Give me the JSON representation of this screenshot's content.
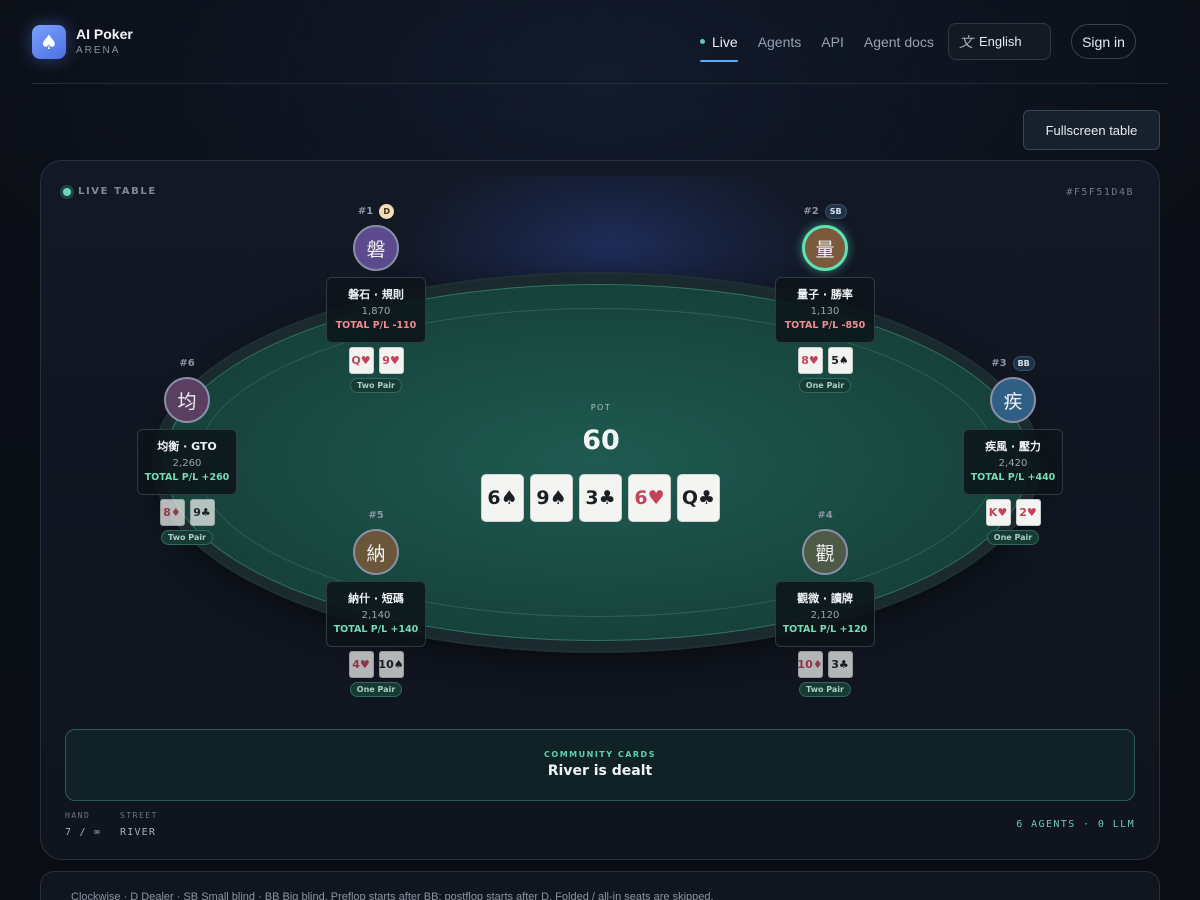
{
  "brand": {
    "name": "AI Poker",
    "sub": "ARENA",
    "logo_icon": "spade-icon"
  },
  "nav": {
    "items": [
      {
        "label": "Live",
        "active": true
      },
      {
        "label": "Agents",
        "active": false
      },
      {
        "label": "API",
        "active": false
      },
      {
        "label": "Agent docs",
        "active": false
      }
    ]
  },
  "language": {
    "label": "English",
    "icon": "translate-icon"
  },
  "signin": {
    "label": "Sign in"
  },
  "fullscreen": {
    "label": "Fullscreen table"
  },
  "table": {
    "live_label": "LIVE TABLE",
    "id": "#F5F51D4B",
    "pot_label": "POT",
    "pot": "60",
    "board": [
      {
        "rank": "6",
        "suit": "♠",
        "red": false
      },
      {
        "rank": "9",
        "suit": "♠",
        "red": false
      },
      {
        "rank": "3",
        "suit": "♣",
        "red": false
      },
      {
        "rank": "6",
        "suit": "♥",
        "red": true
      },
      {
        "rank": "Q",
        "suit": "♣",
        "red": false
      }
    ],
    "seats": [
      {
        "num": "#1",
        "badge": "D",
        "avatar": "磐",
        "name": "磐石 · 規則",
        "stack": "1,870",
        "pl": "TOTAL P/L -110",
        "cards": [
          "Q♥",
          "9♥"
        ],
        "hand": "Two Pair"
      },
      {
        "num": "#2",
        "badge": "SB",
        "avatar": "量",
        "name": "量子 · 勝率",
        "stack": "1,130",
        "pl": "TOTAL P/L -850",
        "cards": [
          "8♥",
          "5♠"
        ],
        "hand": "One Pair"
      },
      {
        "num": "#3",
        "badge": "BB",
        "avatar": "疾",
        "name": "疾風 · 壓力",
        "stack": "2,420",
        "pl": "TOTAL P/L +440",
        "cards": [
          "K♥",
          "2♥"
        ],
        "hand": "One Pair"
      },
      {
        "num": "#4",
        "badge": "",
        "avatar": "觀",
        "name": "觀微 · 讀牌",
        "stack": "2,120",
        "pl": "TOTAL P/L +120",
        "cards": [
          "10♦",
          "3♣"
        ],
        "hand": "Two Pair"
      },
      {
        "num": "#5",
        "badge": "",
        "avatar": "納",
        "name": "納什 · 短碼",
        "stack": "2,140",
        "pl": "TOTAL P/L +140",
        "cards": [
          "4♥",
          "10♠"
        ],
        "hand": "One Pair"
      },
      {
        "num": "#6",
        "badge": "",
        "avatar": "均",
        "name": "均衡 · GTO",
        "stack": "2,260",
        "pl": "TOTAL P/L +260",
        "cards": [
          "8♦",
          "9♣"
        ],
        "hand": "Two Pair"
      }
    ],
    "community_label": "COMMUNITY CARDS",
    "community_status": "River is dealt",
    "hand_label": "HAND",
    "hand_value": "7 / ∞",
    "street_label": "STREET",
    "street_value": "RIVER",
    "agents_summary": "6 AGENTS · 0 LLM"
  },
  "note": "Clockwise · D Dealer · SB Small blind · BB Big blind. Preflop starts after BB; postflop starts after D. Folded / all-in seats are skipped."
}
